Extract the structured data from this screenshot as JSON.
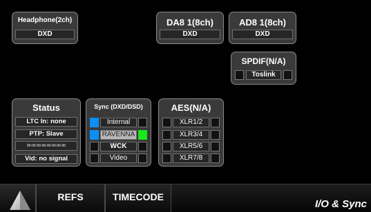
{
  "headphone": {
    "title": "Headphone(2ch)",
    "value": "DXD"
  },
  "da8": {
    "title": "DA8 1(8ch)",
    "value": "DXD"
  },
  "ad8": {
    "title": "AD8 1(8ch)",
    "value": "DXD"
  },
  "spdif": {
    "title": "SPDIF(N/A)",
    "label": "Toslink"
  },
  "status": {
    "title": "Status",
    "ltc": "LTC In: none",
    "ptp": "PTP: Slave",
    "ptp_id": "00-00-00-00-00-00-00-00",
    "vid": "Vid: no signal"
  },
  "sync": {
    "title": "Sync (DXD/DSD)",
    "options": [
      {
        "label": "Internal",
        "selected": true,
        "locked": false
      },
      {
        "label": "RAVENNA",
        "selected": true,
        "locked": true
      },
      {
        "label": "WCK",
        "selected": false,
        "locked": false
      },
      {
        "label": "Video",
        "selected": false,
        "locked": false
      }
    ]
  },
  "aes": {
    "title": "AES(N/A)",
    "inputs": [
      {
        "label": "XLR1/2"
      },
      {
        "label": "XLR3/4"
      },
      {
        "label": "XLR5/6"
      },
      {
        "label": "XLR7/8"
      }
    ]
  },
  "nav": {
    "tabs": [
      {
        "label": "REFS"
      },
      {
        "label": "TIMECODE"
      }
    ],
    "page_title": "I/O & Sync"
  },
  "colors": {
    "selected": "#0c8ff2",
    "locked": "#19e81a"
  }
}
